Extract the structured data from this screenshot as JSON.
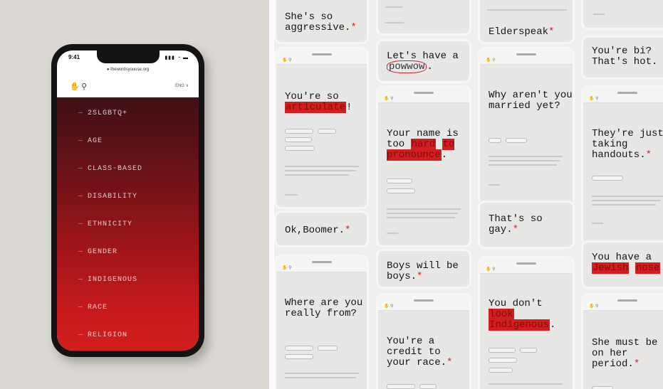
{
  "phone": {
    "time": "9:41",
    "url": "● thewordsyouuse.org",
    "status_icons": "▮▮▮ ◔ ▬",
    "language": "ENG  ∨",
    "categories": [
      "2SLGBTQ+",
      "AGE",
      "CLASS-BASED",
      "DISABILITY",
      "ETHNICITY",
      "GENDER",
      "INDIGENOUS",
      "RACE",
      "RELIGION"
    ],
    "category_dash": "—"
  },
  "phrases": {
    "aggressive": {
      "text": "She's so aggressive.",
      "mark": "*"
    },
    "powwow_pre": "Let's have a ",
    "powwow_hl": "powwow",
    "powwow_post": ".",
    "elderspeak": "Elderspeak",
    "bi": "You're bi? That's hot.",
    "articulate_pre": "You're so ",
    "articulate_hl": "articulate",
    "articulate_post": "!",
    "name_pre": "Your name is too ",
    "name_hl1": "hard",
    "name_hl2": "to pronounce",
    "name_post": ".",
    "married": "Why aren't you married yet?",
    "handouts": "They're just taking handouts.",
    "boomer": "Ok,Boomer.",
    "gay": "That's so gay.",
    "nose_pre": "You have a ",
    "nose_hl1": "Jewish",
    "nose_hl2": "nose",
    "nose_post": ".",
    "boys": "Boys will be boys.",
    "where": "Where are you really from?",
    "indig_pre": "You don't ",
    "indig_hl1": "look",
    "indig_hl2": "Indigenous",
    "indig_post": ".",
    "credit": "You're a credit to your race.",
    "period": "She must be on her period.",
    "asterisk": "*"
  },
  "colors": {
    "accent_red": "#d21e1e",
    "dark_maroon": "#3e1016"
  }
}
